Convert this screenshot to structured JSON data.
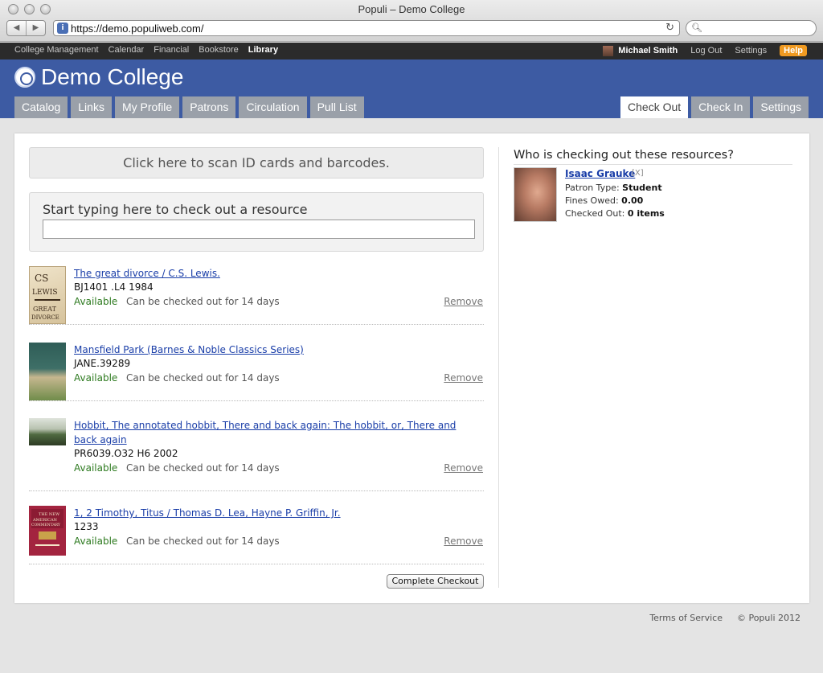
{
  "window": {
    "title": "Populi – Demo College",
    "url": "https://demo.populiweb.com/"
  },
  "topnav": {
    "items": [
      "College Management",
      "Calendar",
      "Financial",
      "Bookstore",
      "Library"
    ],
    "active": "Library",
    "user_name": "Michael Smith",
    "logout": "Log Out",
    "settings": "Settings",
    "help": "Help"
  },
  "header": {
    "brand": "Demo College",
    "tabs_left": [
      "Catalog",
      "Links",
      "My Profile",
      "Patrons",
      "Circulation",
      "Pull List"
    ],
    "tabs_right": [
      "Check Out",
      "Check In",
      "Settings"
    ],
    "active_tab": "Check Out"
  },
  "checkout": {
    "scan_label": "Click here to scan ID cards and barcodes.",
    "type_label": "Start typing here to check out a resource",
    "input_value": "",
    "complete_button": "Complete Checkout",
    "remove_label": "Remove",
    "resources": [
      {
        "title": "The great divorce / C.S. Lewis.",
        "call_number": "BJ1401 .L4 1984",
        "status": "Available",
        "loan": "Can be checked out for 14 days"
      },
      {
        "title": "Mansfield Park (Barnes & Noble Classics Series)",
        "call_number": "JANE.39289",
        "status": "Available",
        "loan": "Can be checked out for 14 days"
      },
      {
        "title": "Hobbit, The annotated hobbit, There and back again: The hobbit, or, There and back again",
        "call_number": "PR6039.O32 H6 2002",
        "status": "Available",
        "loan": "Can be checked out for 14 days"
      },
      {
        "title": "1, 2 Timothy, Titus / Thomas D. Lea, Hayne P. Griffin, Jr.",
        "call_number": "1233",
        "status": "Available",
        "loan": "Can be checked out for 14 days"
      }
    ]
  },
  "patron": {
    "heading": "Who is checking out these resources?",
    "name": "Isaac Grauke",
    "remove": "[X]",
    "type_label": "Patron Type:",
    "type_value": "Student",
    "fines_label": "Fines Owed:",
    "fines_value": "0.00",
    "checked_label": "Checked Out:",
    "checked_value": "0 items"
  },
  "footer": {
    "terms": "Terms of Service",
    "copyright": "© Populi 2012"
  }
}
